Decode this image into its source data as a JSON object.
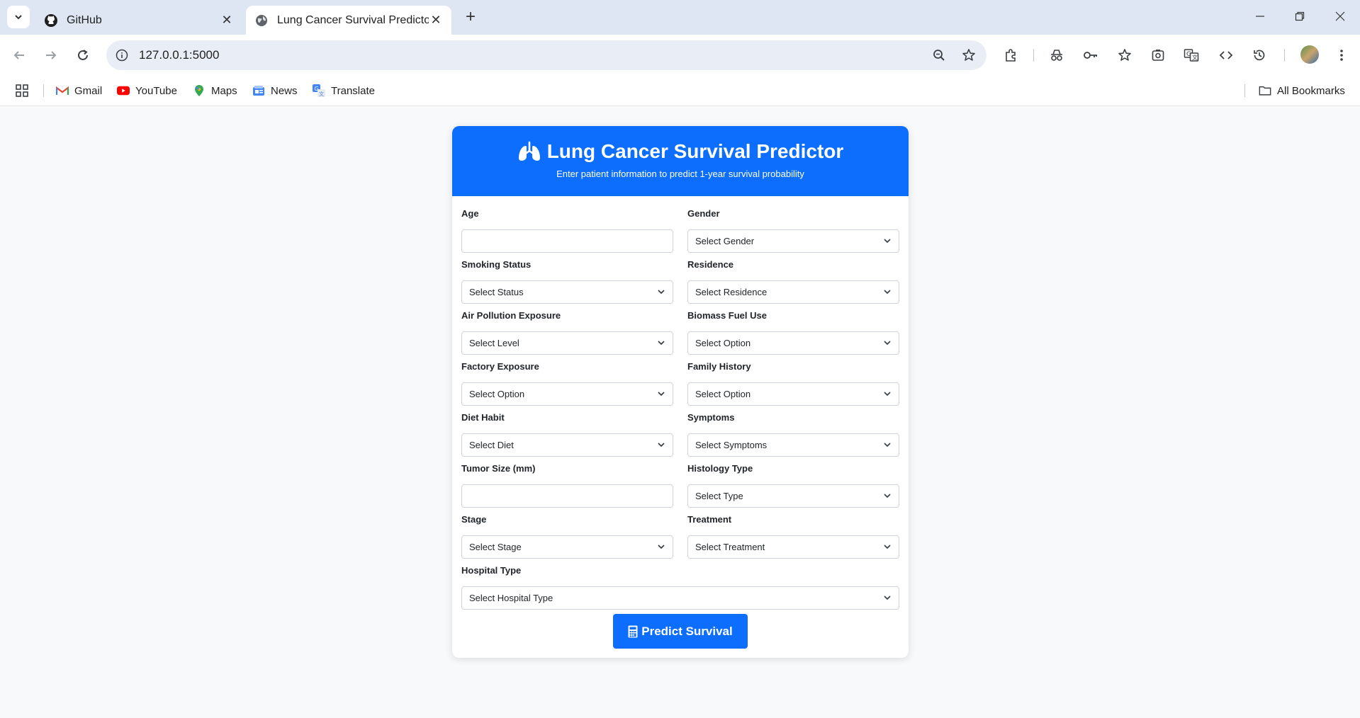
{
  "browser": {
    "tabs": [
      {
        "title": "GitHub",
        "active": false
      },
      {
        "title": "Lung Cancer Survival Predictor",
        "active": true
      }
    ],
    "url": "127.0.0.1:5000",
    "bookmarks": [
      {
        "label": "Gmail",
        "icon": "gmail-icon"
      },
      {
        "label": "YouTube",
        "icon": "youtube-icon"
      },
      {
        "label": "Maps",
        "icon": "maps-icon"
      },
      {
        "label": "News",
        "icon": "news-icon"
      },
      {
        "label": "Translate",
        "icon": "translate-icon"
      }
    ],
    "all_bookmarks": "All Bookmarks"
  },
  "app": {
    "title": "Lung Cancer Survival Predictor",
    "subtitle": "Enter patient information to predict 1-year survival probability",
    "accent_color": "#0d6efd",
    "fields": {
      "age": {
        "label": "Age",
        "value": ""
      },
      "gender": {
        "label": "Gender",
        "value": "Select Gender"
      },
      "smoking": {
        "label": "Smoking Status",
        "value": "Select Status"
      },
      "residence": {
        "label": "Residence",
        "value": "Select Residence"
      },
      "air": {
        "label": "Air Pollution Exposure",
        "value": "Select Level"
      },
      "biomass": {
        "label": "Biomass Fuel Use",
        "value": "Select Option"
      },
      "factory": {
        "label": "Factory Exposure",
        "value": "Select Option"
      },
      "family": {
        "label": "Family History",
        "value": "Select Option"
      },
      "diet": {
        "label": "Diet Habit",
        "value": "Select Diet"
      },
      "symptoms": {
        "label": "Symptoms",
        "value": "Select Symptoms"
      },
      "tumor": {
        "label": "Tumor Size (mm)",
        "value": ""
      },
      "histology": {
        "label": "Histology Type",
        "value": "Select Type"
      },
      "stage": {
        "label": "Stage",
        "value": "Select Stage"
      },
      "treatment": {
        "label": "Treatment",
        "value": "Select Treatment"
      },
      "hospital": {
        "label": "Hospital Type",
        "value": "Select Hospital Type"
      }
    },
    "submit_label": "Predict Survival"
  }
}
